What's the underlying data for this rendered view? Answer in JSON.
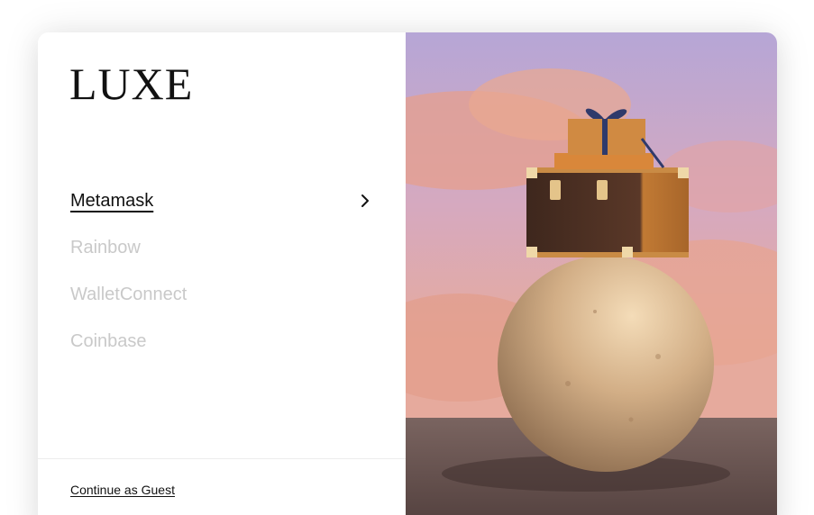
{
  "brand": {
    "logo_text": "LUXE"
  },
  "wallets": [
    {
      "label": "Metamask",
      "active": true
    },
    {
      "label": "Rainbow",
      "active": false
    },
    {
      "label": "WalletConnect",
      "active": false
    },
    {
      "label": "Coinbase",
      "active": false
    }
  ],
  "footer": {
    "guest_label": "Continue as Guest"
  },
  "icons": {
    "chevron": "chevron-right-icon"
  },
  "colors": {
    "text_primary": "#111111",
    "text_muted": "#c9c9c9",
    "sky_top": "#b9a7d8",
    "sky_bottom": "#e8a99b",
    "cloud": "#e8a088",
    "floor": "#6b5551",
    "sphere": "#d7b48e",
    "trunk": "#4a2f22",
    "box": "#d88b3a"
  }
}
